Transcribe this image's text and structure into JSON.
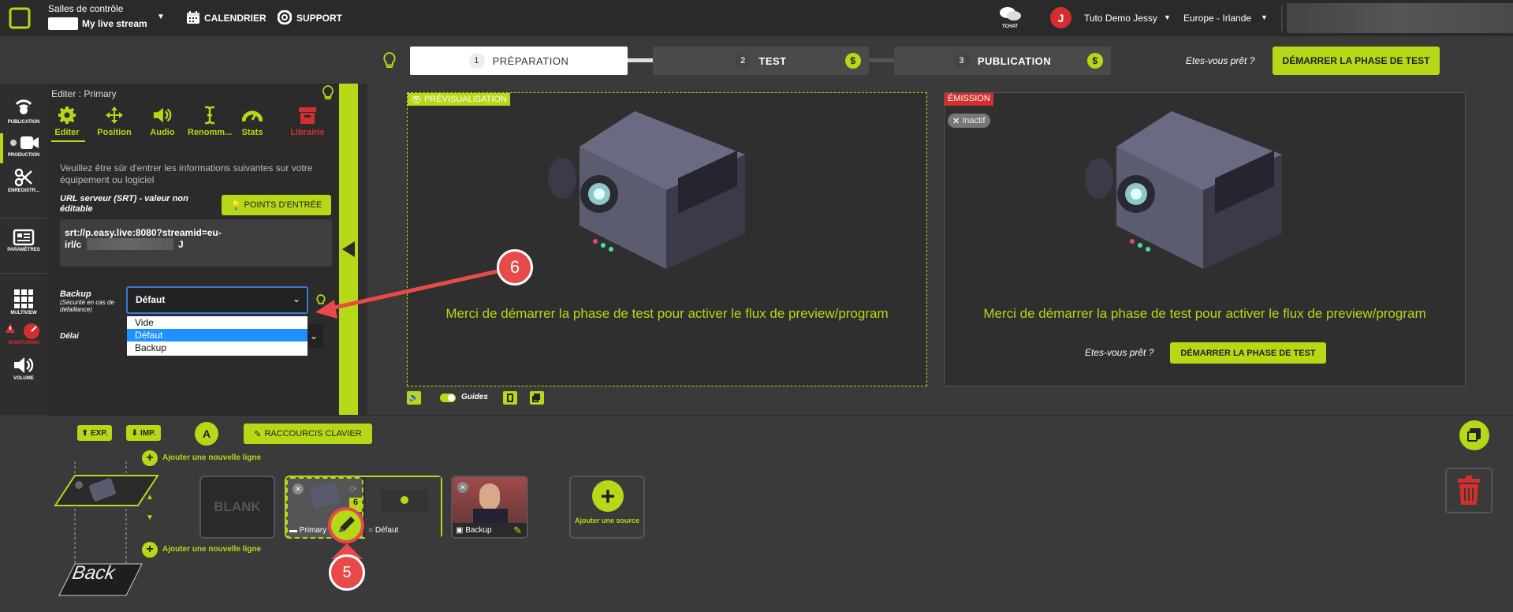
{
  "header": {
    "control_rooms_label": "Salles de contrôle",
    "stream_name": "My live stream",
    "calendar_label": "CALENDRIER",
    "support_label": "SUPPORT",
    "chat_label": "TCHAT",
    "user_initial": "J",
    "user_name": "Tuto Demo Jessy",
    "region": "Europe - Irlande"
  },
  "steps": {
    "items": [
      {
        "num": "1",
        "label": "PRÉPARATION"
      },
      {
        "num": "2",
        "label": "TEST"
      },
      {
        "num": "3",
        "label": "PUBLICATION"
      }
    ],
    "dollar": "$",
    "ready_text": "Etes-vous prêt ?",
    "start_test_button": "DÉMARRER LA PHASE DE TEST"
  },
  "leftnav": {
    "items": [
      "PUBLICATION",
      "PRODUCTION",
      "ENREGISTR...",
      "PARAMÈTRES",
      "MULTIVIEW",
      "MONITORING",
      "VOLUME"
    ]
  },
  "editor": {
    "title": "Editer : Primary",
    "tabs": [
      "Editer",
      "Position",
      "Audio",
      "Renomm...",
      "Stats",
      "Librairie"
    ],
    "instructions": "Veuillez être sûr d'entrer les informations suivantes sur votre équipement ou logiciel",
    "url_label": "URL serveur (SRT) - valeur non éditable",
    "entry_points_button": "POINTS D'ENTRÉE",
    "url_line1": "srt://p.easy.live:8080?streamid=eu-",
    "url_line2_start": "irl/c",
    "url_line2_end": "J",
    "backup_label": "Backup",
    "backup_sub": "(Sécurité en cas de défaillance)",
    "backup_value": "Défaut",
    "delay_label": "Délai",
    "dropdown_options": [
      "Vide",
      "Défaut",
      "Backup"
    ]
  },
  "preview": {
    "preview_tag": "PRÉVISUALISATION",
    "emission_tag": "ÉMISSION",
    "inactive_badge": "Inactif",
    "message": "Merci de démarrer la phase de test pour activer le flux de preview/program",
    "ready_text": "Etes-vous prêt ?",
    "start_test_button": "DÉMARRER LA PHASE DE TEST",
    "guides_label": "Guides"
  },
  "callouts": {
    "six": "6",
    "five": "5"
  },
  "bottom": {
    "exp_button": "EXP.",
    "imp_button": "IMP.",
    "a_badge": "A",
    "shortcuts_button": "RACCOURCIS CLAVIER",
    "add_line_top": "Ajouter une nouvelle ligne",
    "add_line_bottom": "Ajouter une nouvelle ligne",
    "blank_label": "BLANK",
    "back_label": "Back",
    "sources": [
      {
        "label": "Primary"
      },
      {
        "label": "Défaut"
      },
      {
        "label": "Backup"
      }
    ],
    "add_source_label": "Ajouter une source"
  },
  "colors": {
    "accent": "#b5d916",
    "danger": "#d32f2f",
    "background": "#3a3a3a"
  }
}
